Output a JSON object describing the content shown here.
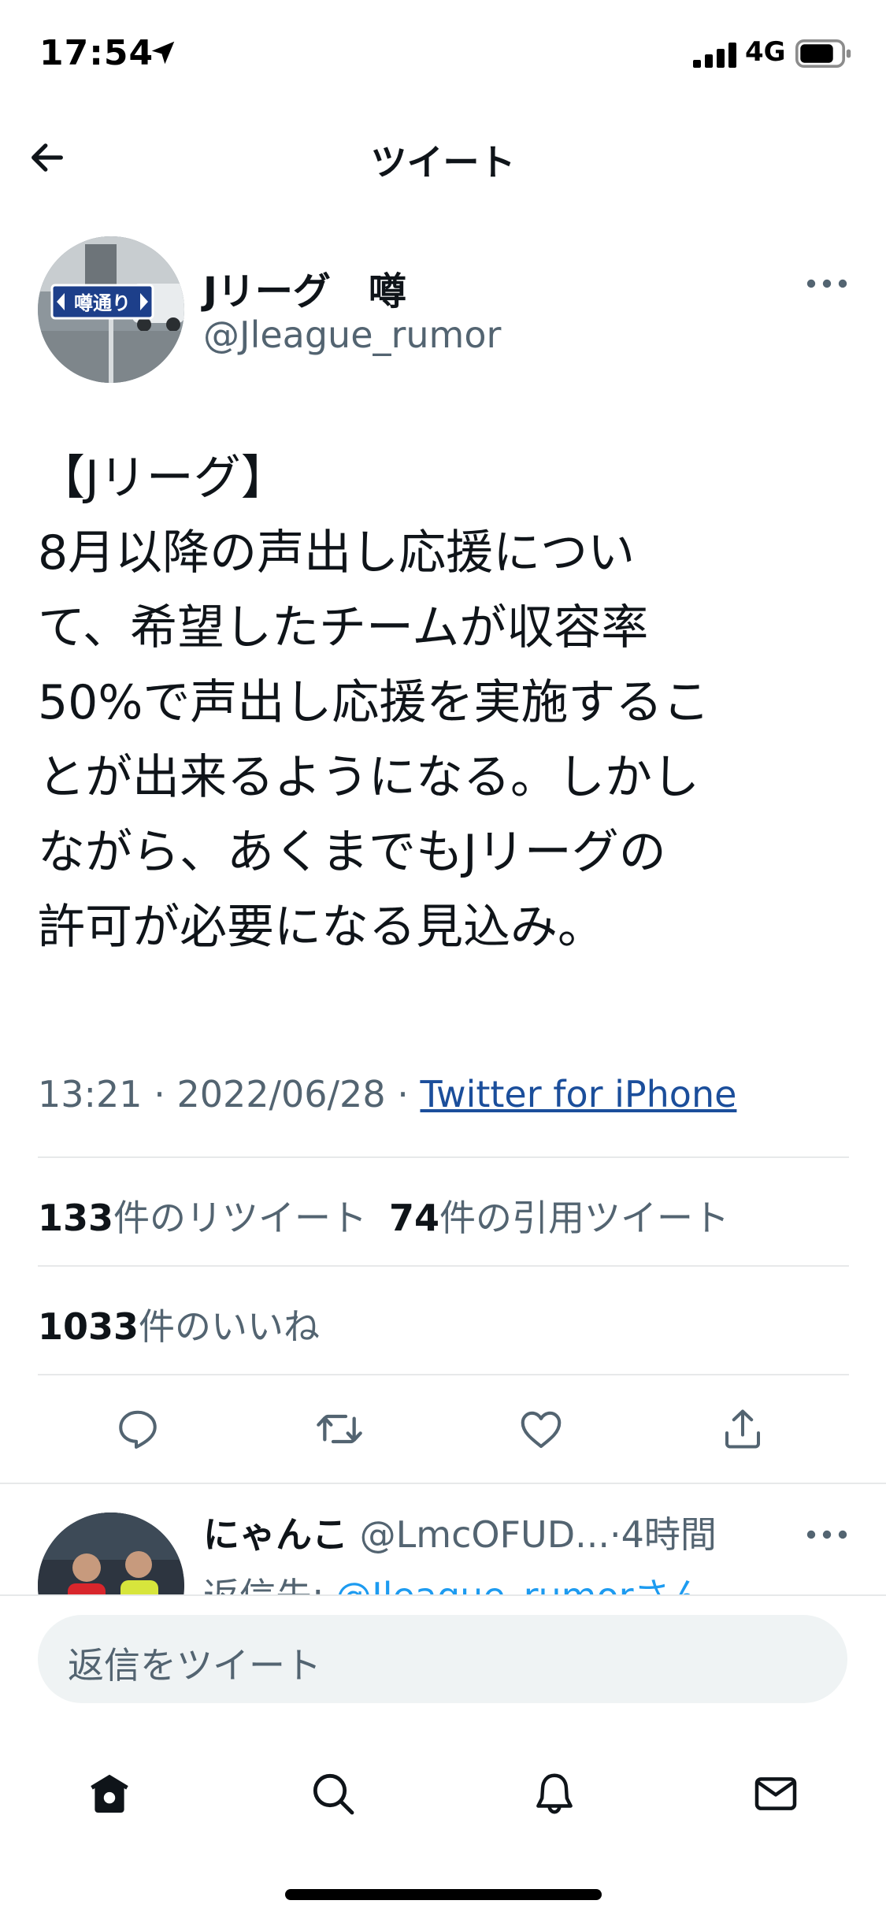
{
  "status_bar": {
    "time": "17:54",
    "network": "4G"
  },
  "nav": {
    "title": "ツイート"
  },
  "tweet": {
    "author_name": "Jリーグ　噂",
    "author_handle": "@Jleague_rumor",
    "avatar_sign": "噂通り",
    "text": "【Jリーグ】\n8月以降の声出し応援につい\nて、希望したチームが収容率\n50%で声出し応援を実施するこ\nとが出来るようになる。しかし\nながら、あくまでもJリーグの\n許可が必要になる見込み。",
    "time": "13:21",
    "date": "2022/06/28",
    "source": "Twitter for iPhone",
    "separator": "·"
  },
  "stats": {
    "retweets_count": "133",
    "retweets_label": "件のリツイート",
    "quotes_count": "74",
    "quotes_label": "件の引用ツイート",
    "likes_count": "1033",
    "likes_label": "件のいいね"
  },
  "reply": {
    "name": "にゃんこ",
    "handle": "@LmcOFUD...",
    "time_sep": "·",
    "time": "4時間",
    "reply_to_label": "返信先:",
    "reply_to_user": "@Jleague_rumorさん"
  },
  "compose": {
    "placeholder": "返信をツイート"
  },
  "colors": {
    "accent": "#1d9bf0",
    "link": "#1b4e9b",
    "secondary_text": "#536471"
  },
  "icons": {
    "back": "arrow-left-icon",
    "more": "more-horizontal-icon",
    "reply": "reply-icon",
    "retweet": "retweet-icon",
    "like": "heart-icon",
    "share": "share-icon",
    "home": "home-icon",
    "search": "search-icon",
    "notifications": "bell-icon",
    "messages": "mail-icon"
  }
}
